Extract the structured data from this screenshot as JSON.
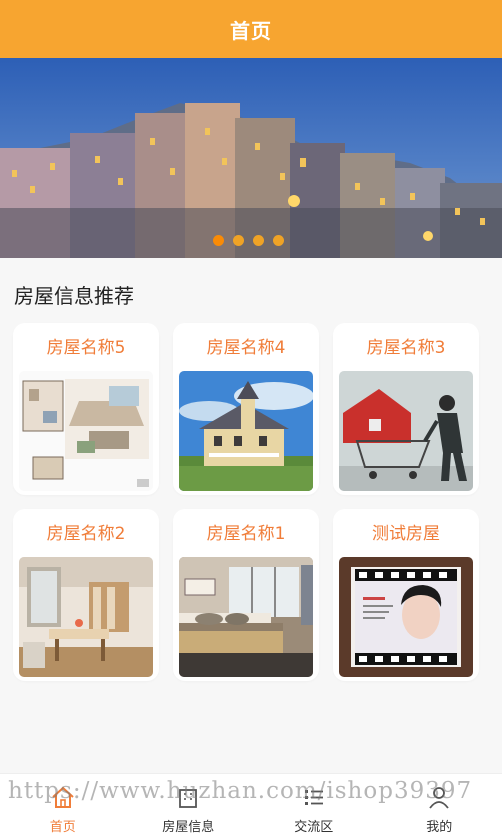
{
  "header": {
    "title": "首页"
  },
  "banner": {
    "slides": 4,
    "active_slide": 1,
    "image": "coastal-colorful-houses-at-dusk"
  },
  "section": {
    "title": "房屋信息推荐"
  },
  "houses": [
    {
      "name": "房屋名称5",
      "image": "floor-plan-illustration"
    },
    {
      "name": "房屋名称4",
      "image": "victorian-house-photo"
    },
    {
      "name": "房屋名称3",
      "image": "house-in-shopping-cart-illustration"
    },
    {
      "name": "房屋名称2",
      "image": "loft-living-room-photo"
    },
    {
      "name": "房屋名称1",
      "image": "bedroom-photo"
    },
    {
      "name": "测试房屋",
      "image": "portrait-in-film-frame"
    }
  ],
  "tabbar": [
    {
      "label": "首页",
      "icon": "home-icon",
      "active": true
    },
    {
      "label": "房屋信息",
      "icon": "building-icon",
      "active": false
    },
    {
      "label": "交流区",
      "icon": "list-icon",
      "active": false
    },
    {
      "label": "我的",
      "icon": "user-icon",
      "active": false
    }
  ],
  "watermark": {
    "text": "https://www.huzhan.com/ishop39397"
  },
  "colors": {
    "accent": "#f7a530",
    "title": "#f07d39",
    "background": "#f7f7f7"
  }
}
